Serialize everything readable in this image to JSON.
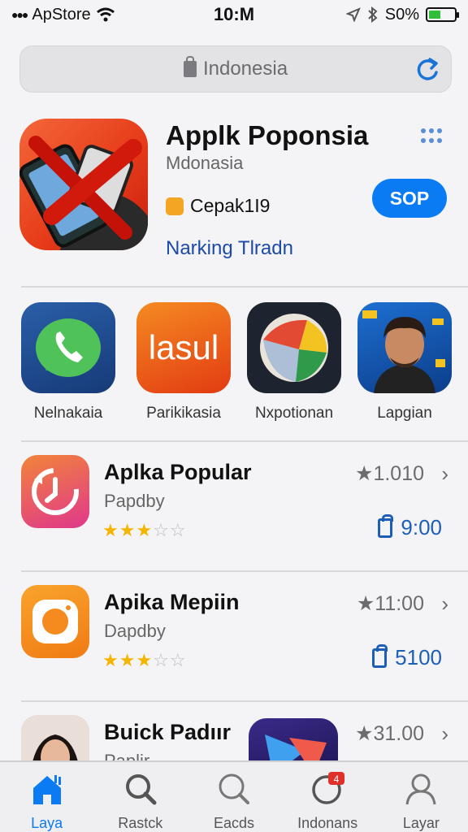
{
  "status_bar": {
    "carrier": "ApStore",
    "time": "10:M",
    "battery_text": "S0%"
  },
  "search": {
    "text": "Indonesia"
  },
  "featured": {
    "title": "Applk Poponsia",
    "subtitle": "Mdonasia",
    "badge_text": "Cepak1I9",
    "link_text": "Narking Tlradn",
    "button_label": "SOP"
  },
  "carousel": {
    "items": [
      {
        "label": "Nelnakaia",
        "icon": "phone-chat-icon"
      },
      {
        "label": "Parikikasia",
        "icon_text": "lasul"
      },
      {
        "label": "Nxpotionan",
        "icon": "colorful-ball-icon"
      },
      {
        "label": "Lapgian",
        "icon": "portrait-app-icon"
      }
    ]
  },
  "list": [
    {
      "title": "Aplka Popular",
      "subtitle": "Papdby",
      "stars": 3,
      "rating": "1.010",
      "price": "9:00",
      "icon": "refresh-clock-icon"
    },
    {
      "title": "Apika Mepiin",
      "subtitle": "Dapdby",
      "stars": 3,
      "rating": "11:00",
      "price": "5100",
      "icon": "camera-app-icon"
    },
    {
      "title": "Buick Padıır",
      "subtitle": "Paplir",
      "rating": "31.00",
      "icon": "portrait-app-icon"
    }
  ],
  "tabs": [
    {
      "label": "Laya",
      "icon": "home-icon",
      "active": true
    },
    {
      "label": "Rastck",
      "icon": "search-icon"
    },
    {
      "label": "Eacds",
      "icon": "search-icon"
    },
    {
      "label": "Indonans",
      "icon": "notification-icon",
      "badge": "4"
    },
    {
      "label": "Layar",
      "icon": "profile-icon"
    }
  ],
  "colors": {
    "accent": "#0a7bf2",
    "link": "#1d4aa8",
    "star": "#f5b400"
  }
}
